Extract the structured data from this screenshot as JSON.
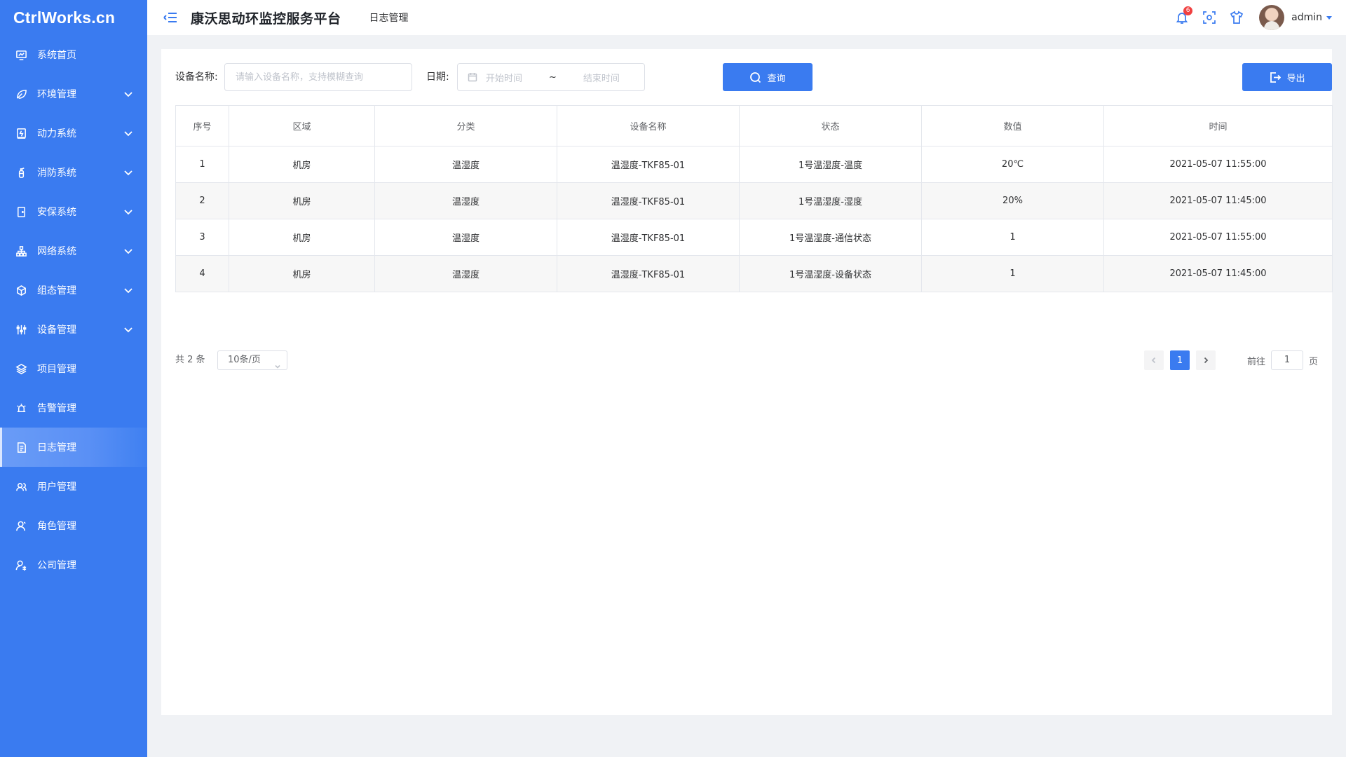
{
  "app": {
    "logo": "CtrlWorks.cn",
    "title": "康沃思动环监控服务平台",
    "breadcrumb": "日志管理"
  },
  "sidebar": {
    "items": [
      {
        "label": "系统首页",
        "icon": "monitor-chart-icon",
        "expandable": false
      },
      {
        "label": "环境管理",
        "icon": "leaf-icon",
        "expandable": true
      },
      {
        "label": "动力系统",
        "icon": "power-panel-icon",
        "expandable": true
      },
      {
        "label": "消防系统",
        "icon": "fire-extinguisher-icon",
        "expandable": true
      },
      {
        "label": "安保系统",
        "icon": "door-icon",
        "expandable": true
      },
      {
        "label": "网络系统",
        "icon": "network-icon",
        "expandable": true
      },
      {
        "label": "组态管理",
        "icon": "cube-icon",
        "expandable": true
      },
      {
        "label": "设备管理",
        "icon": "sliders-icon",
        "expandable": true
      },
      {
        "label": "项目管理",
        "icon": "layers-icon",
        "expandable": false
      },
      {
        "label": "告警管理",
        "icon": "alarm-light-icon",
        "expandable": false
      },
      {
        "label": "日志管理",
        "icon": "log-file-icon",
        "expandable": false,
        "active": true
      },
      {
        "label": "用户管理",
        "icon": "users-icon",
        "expandable": false
      },
      {
        "label": "角色管理",
        "icon": "role-icon",
        "expandable": false
      },
      {
        "label": "公司管理",
        "icon": "company-user-icon",
        "expandable": false
      }
    ]
  },
  "header": {
    "notification_count": "6",
    "username": "admin",
    "icons": [
      "bell-icon",
      "scan-icon",
      "shirt-icon"
    ]
  },
  "filters": {
    "device_label": "设备名称:",
    "device_placeholder": "请输入设备名称，支持模糊查询",
    "date_label": "日期:",
    "start_placeholder": "开始时间",
    "range_separator": "~",
    "end_placeholder": "结束时间",
    "search_button": "查询",
    "export_button": "导出"
  },
  "table": {
    "columns": [
      "序号",
      "区域",
      "分类",
      "设备名称",
      "状态",
      "数值",
      "时间"
    ],
    "rows": [
      [
        "1",
        "机房",
        "温湿度",
        "温湿度-TKF85-01",
        "1号温湿度-温度",
        "20℃",
        "2021-05-07 11:55:00"
      ],
      [
        "2",
        "机房",
        "温湿度",
        "温湿度-TKF85-01",
        "1号温湿度-湿度",
        "20%",
        "2021-05-07 11:45:00"
      ],
      [
        "3",
        "机房",
        "温湿度",
        "温湿度-TKF85-01",
        "1号温湿度-通信状态",
        "1",
        "2021-05-07 11:55:00"
      ],
      [
        "4",
        "机房",
        "温湿度",
        "温湿度-TKF85-01",
        "1号温湿度-设备状态",
        "1",
        "2021-05-07 11:45:00"
      ]
    ]
  },
  "pagination": {
    "total_text": "共 2 条",
    "page_size": "10条/页",
    "current_page": "1",
    "goto_label": "前往",
    "goto_value": "1",
    "goto_suffix": "页"
  },
  "colors": {
    "primary": "#3a7bf0",
    "badge": "#f04040"
  }
}
